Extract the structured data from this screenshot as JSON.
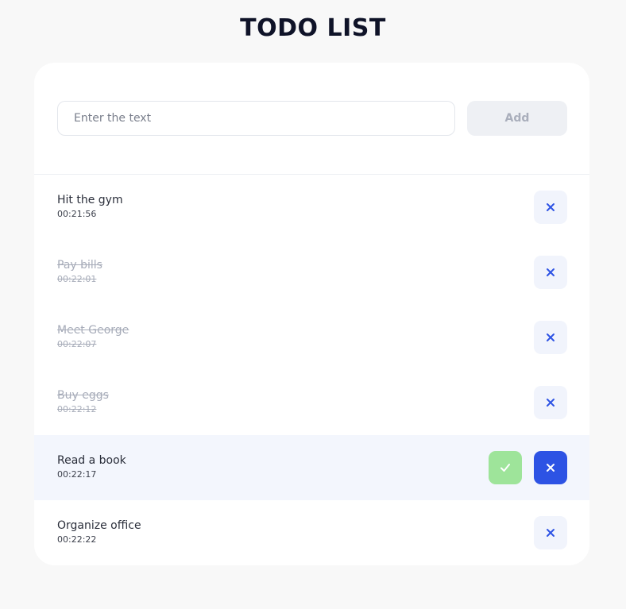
{
  "page": {
    "title": "TODO LIST"
  },
  "add_form": {
    "placeholder": "Enter the text",
    "value": "",
    "add_label": "Add"
  },
  "todos": [
    {
      "text": "Hit the gym",
      "time": "00:21:56",
      "completed": false
    },
    {
      "text": "Pay bills",
      "time": "00:22:01",
      "completed": true
    },
    {
      "text": "Meet George",
      "time": "00:22:07",
      "completed": true
    },
    {
      "text": "Buy eggs",
      "time": "00:22:12",
      "completed": true
    },
    {
      "text": "Read a book",
      "time": "00:22:17",
      "completed": false,
      "hovered": true
    },
    {
      "text": "Organize office",
      "time": "00:22:22",
      "completed": false
    }
  ],
  "icons": {
    "delete": "close-icon",
    "complete": "check-icon"
  },
  "colors": {
    "accent": "#2d53e4",
    "check": "#9ee49a",
    "hover_row": "#f3f6fd",
    "done_text": "#a7acb9"
  }
}
